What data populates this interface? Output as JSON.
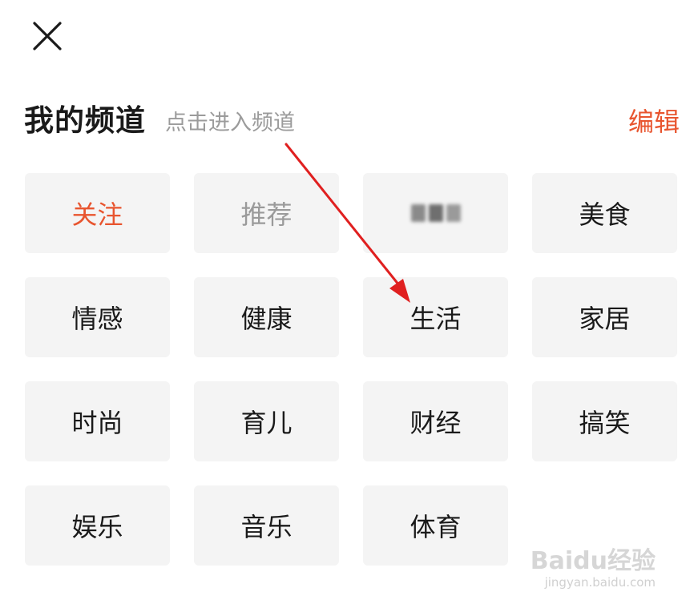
{
  "header": {
    "title": "我的频道",
    "hint": "点击进入频道",
    "edit_label": "编辑"
  },
  "channels": [
    {
      "label": "关注",
      "state": "followed"
    },
    {
      "label": "推荐",
      "state": "fixed"
    },
    {
      "label": "",
      "state": "blurred"
    },
    {
      "label": "美食",
      "state": "normal"
    },
    {
      "label": "情感",
      "state": "normal"
    },
    {
      "label": "健康",
      "state": "normal"
    },
    {
      "label": "生活",
      "state": "normal"
    },
    {
      "label": "家居",
      "state": "normal"
    },
    {
      "label": "时尚",
      "state": "normal"
    },
    {
      "label": "育儿",
      "state": "normal"
    },
    {
      "label": "财经",
      "state": "normal"
    },
    {
      "label": "搞笑",
      "state": "normal"
    },
    {
      "label": "娱乐",
      "state": "normal"
    },
    {
      "label": "音乐",
      "state": "normal"
    },
    {
      "label": "体育",
      "state": "normal"
    }
  ],
  "watermark": {
    "logo": "Baidu经验",
    "url": "jingyan.baidu.com"
  },
  "icons": {
    "close": "close-icon",
    "annotation": "red-arrow-icon"
  },
  "colors": {
    "accent": "#e8552f",
    "chip_bg": "#f4f4f4",
    "hint": "#9b9b9b",
    "arrow": "#e02020"
  }
}
